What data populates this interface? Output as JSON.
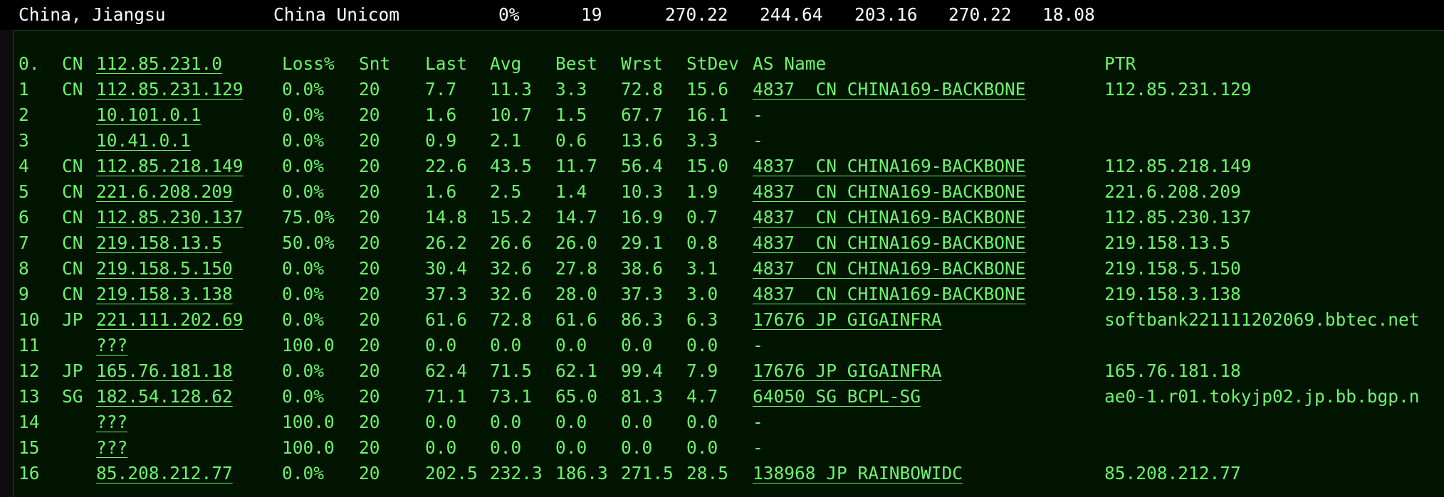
{
  "summary": {
    "location": "China, Jiangsu",
    "isp": "China Unicom",
    "loss": "0%",
    "sent": "19",
    "last": "270.22",
    "avg": "244.64",
    "best": "203.16",
    "worst": "270.22",
    "stdev": "18.08"
  },
  "header": {
    "hop": "0.",
    "cc": "CN",
    "host": "112.85.231.0",
    "loss": "Loss%",
    "snt": "Snt",
    "last": "Last",
    "avg": "Avg",
    "best": "Best",
    "wrst": "Wrst",
    "stdev": "StDev",
    "asname": "AS Name",
    "ptr": "PTR"
  },
  "hops": [
    {
      "hop": "1",
      "cc": "CN",
      "host": "112.85.231.129",
      "loss": "0.0%",
      "snt": "20",
      "last": "7.7",
      "avg": "11.3",
      "best": "3.3",
      "wrst": "72.8",
      "stdev": "15.6",
      "as": "4837  CN CHINA169-BACKBONE",
      "ptr": "112.85.231.129"
    },
    {
      "hop": "2",
      "cc": "",
      "host": "10.101.0.1",
      "loss": "0.0%",
      "snt": "20",
      "last": "1.6",
      "avg": "10.7",
      "best": "1.5",
      "wrst": "67.7",
      "stdev": "16.1",
      "as": "-",
      "ptr": ""
    },
    {
      "hop": "3",
      "cc": "",
      "host": "10.41.0.1",
      "loss": "0.0%",
      "snt": "20",
      "last": "0.9",
      "avg": "2.1",
      "best": "0.6",
      "wrst": "13.6",
      "stdev": "3.3",
      "as": "-",
      "ptr": ""
    },
    {
      "hop": "4",
      "cc": "CN",
      "host": "112.85.218.149",
      "loss": "0.0%",
      "snt": "20",
      "last": "22.6",
      "avg": "43.5",
      "best": "11.7",
      "wrst": "56.4",
      "stdev": "15.0",
      "as": "4837  CN CHINA169-BACKBONE",
      "ptr": "112.85.218.149"
    },
    {
      "hop": "5",
      "cc": "CN",
      "host": "221.6.208.209",
      "loss": "0.0%",
      "snt": "20",
      "last": "1.6",
      "avg": "2.5",
      "best": "1.4",
      "wrst": "10.3",
      "stdev": "1.9",
      "as": "4837  CN CHINA169-BACKBONE",
      "ptr": "221.6.208.209"
    },
    {
      "hop": "6",
      "cc": "CN",
      "host": "112.85.230.137",
      "loss": "75.0%",
      "snt": "20",
      "last": "14.8",
      "avg": "15.2",
      "best": "14.7",
      "wrst": "16.9",
      "stdev": "0.7",
      "as": "4837  CN CHINA169-BACKBONE",
      "ptr": "112.85.230.137"
    },
    {
      "hop": "7",
      "cc": "CN",
      "host": "219.158.13.5",
      "loss": "50.0%",
      "snt": "20",
      "last": "26.2",
      "avg": "26.6",
      "best": "26.0",
      "wrst": "29.1",
      "stdev": "0.8",
      "as": "4837  CN CHINA169-BACKBONE",
      "ptr": "219.158.13.5"
    },
    {
      "hop": "8",
      "cc": "CN",
      "host": "219.158.5.150",
      "loss": "0.0%",
      "snt": "20",
      "last": "30.4",
      "avg": "32.6",
      "best": "27.8",
      "wrst": "38.6",
      "stdev": "3.1",
      "as": "4837  CN CHINA169-BACKBONE",
      "ptr": "219.158.5.150"
    },
    {
      "hop": "9",
      "cc": "CN",
      "host": "219.158.3.138",
      "loss": "0.0%",
      "snt": "20",
      "last": "37.3",
      "avg": "32.6",
      "best": "28.0",
      "wrst": "37.3",
      "stdev": "3.0",
      "as": "4837  CN CHINA169-BACKBONE",
      "ptr": "219.158.3.138"
    },
    {
      "hop": "10",
      "cc": "JP",
      "host": "221.111.202.69",
      "loss": "0.0%",
      "snt": "20",
      "last": "61.6",
      "avg": "72.8",
      "best": "61.6",
      "wrst": "86.3",
      "stdev": "6.3",
      "as": "17676 JP GIGAINFRA",
      "ptr": "softbank221111202069.bbtec.net"
    },
    {
      "hop": "11",
      "cc": "",
      "host": "???",
      "loss": "100.0",
      "snt": "20",
      "last": "0.0",
      "avg": "0.0",
      "best": "0.0",
      "wrst": "0.0",
      "stdev": "0.0",
      "as": "-",
      "ptr": ""
    },
    {
      "hop": "12",
      "cc": "JP",
      "host": "165.76.181.18",
      "loss": "0.0%",
      "snt": "20",
      "last": "62.4",
      "avg": "71.5",
      "best": "62.1",
      "wrst": "99.4",
      "stdev": "7.9",
      "as": "17676 JP GIGAINFRA",
      "ptr": "165.76.181.18"
    },
    {
      "hop": "13",
      "cc": "SG",
      "host": "182.54.128.62",
      "loss": "0.0%",
      "snt": "20",
      "last": "71.1",
      "avg": "73.1",
      "best": "65.0",
      "wrst": "81.3",
      "stdev": "4.7",
      "as": "64050 SG BCPL-SG",
      "ptr": "ae0-1.r01.tokyjp02.jp.bb.bgp.n"
    },
    {
      "hop": "14",
      "cc": "",
      "host": "???",
      "loss": "100.0",
      "snt": "20",
      "last": "0.0",
      "avg": "0.0",
      "best": "0.0",
      "wrst": "0.0",
      "stdev": "0.0",
      "as": "-",
      "ptr": ""
    },
    {
      "hop": "15",
      "cc": "",
      "host": "???",
      "loss": "100.0",
      "snt": "20",
      "last": "0.0",
      "avg": "0.0",
      "best": "0.0",
      "wrst": "0.0",
      "stdev": "0.0",
      "as": "-",
      "ptr": ""
    },
    {
      "hop": "16",
      "cc": "",
      "host": "85.208.212.77",
      "loss": "0.0%",
      "snt": "20",
      "last": "202.5",
      "avg": "232.3",
      "best": "186.3",
      "wrst": "271.5",
      "stdev": "28.5",
      "as": "138968 JP RAINBOWIDC",
      "ptr": "85.208.212.77"
    }
  ]
}
